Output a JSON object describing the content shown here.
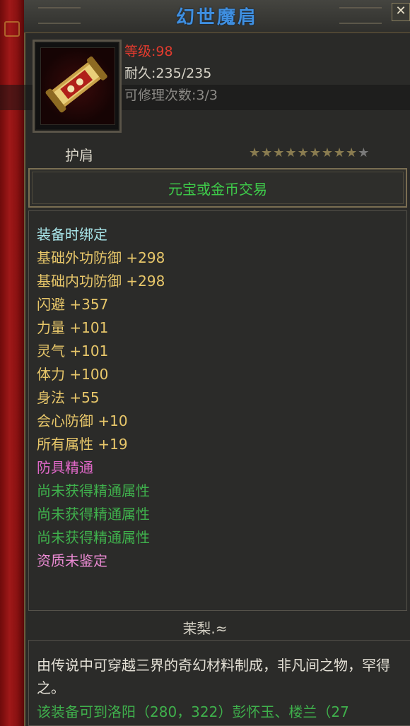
{
  "window": {
    "title": "幻世魔肩",
    "close_icon": "✕"
  },
  "item": {
    "icon": "golden-scroll-icon",
    "level": "等级:98",
    "durability": "耐久:235/235",
    "repair": "可修理次数:3/3",
    "type": "护肩",
    "stars_filled": 9,
    "stars_total": 10,
    "trade": "元宝或金币交易"
  },
  "attributes": [
    {
      "text": "装备时绑定",
      "style": "bind"
    },
    {
      "text": "基础外功防御 +298",
      "style": "gold"
    },
    {
      "text": "基础内功防御 +298",
      "style": "gold"
    },
    {
      "text": "闪避 +357",
      "style": "gold"
    },
    {
      "text": "力量 +101",
      "style": "gold"
    },
    {
      "text": "灵气 +101",
      "style": "gold"
    },
    {
      "text": "体力 +100",
      "style": "gold"
    },
    {
      "text": "身法 +55",
      "style": "gold"
    },
    {
      "text": "会心防御 +10",
      "style": "gold"
    },
    {
      "text": "所有属性 +19",
      "style": "gold"
    },
    {
      "text": "防具精通",
      "style": "pink"
    },
    {
      "text": "尚未获得精通属性",
      "style": "green"
    },
    {
      "text": "尚未获得精通属性",
      "style": "green"
    },
    {
      "text": "尚未获得精通属性",
      "style": "green"
    },
    {
      "text": "资质未鉴定",
      "style": "pink2"
    }
  ],
  "maker": "茉梨.≈",
  "description": "由传说中可穿越三界的奇幻材料制成，非凡间之物，罕得之。",
  "location": "该装备可到洛阳（280，322）彭怀玉、楼兰（27",
  "colors": {
    "title": "#3f8fe0",
    "level": "#e33b2e",
    "trade": "#3ecc4a",
    "attr_gold": "#e8c76a",
    "attr_green": "#3fb04c",
    "attr_pink": "#e068c8"
  }
}
